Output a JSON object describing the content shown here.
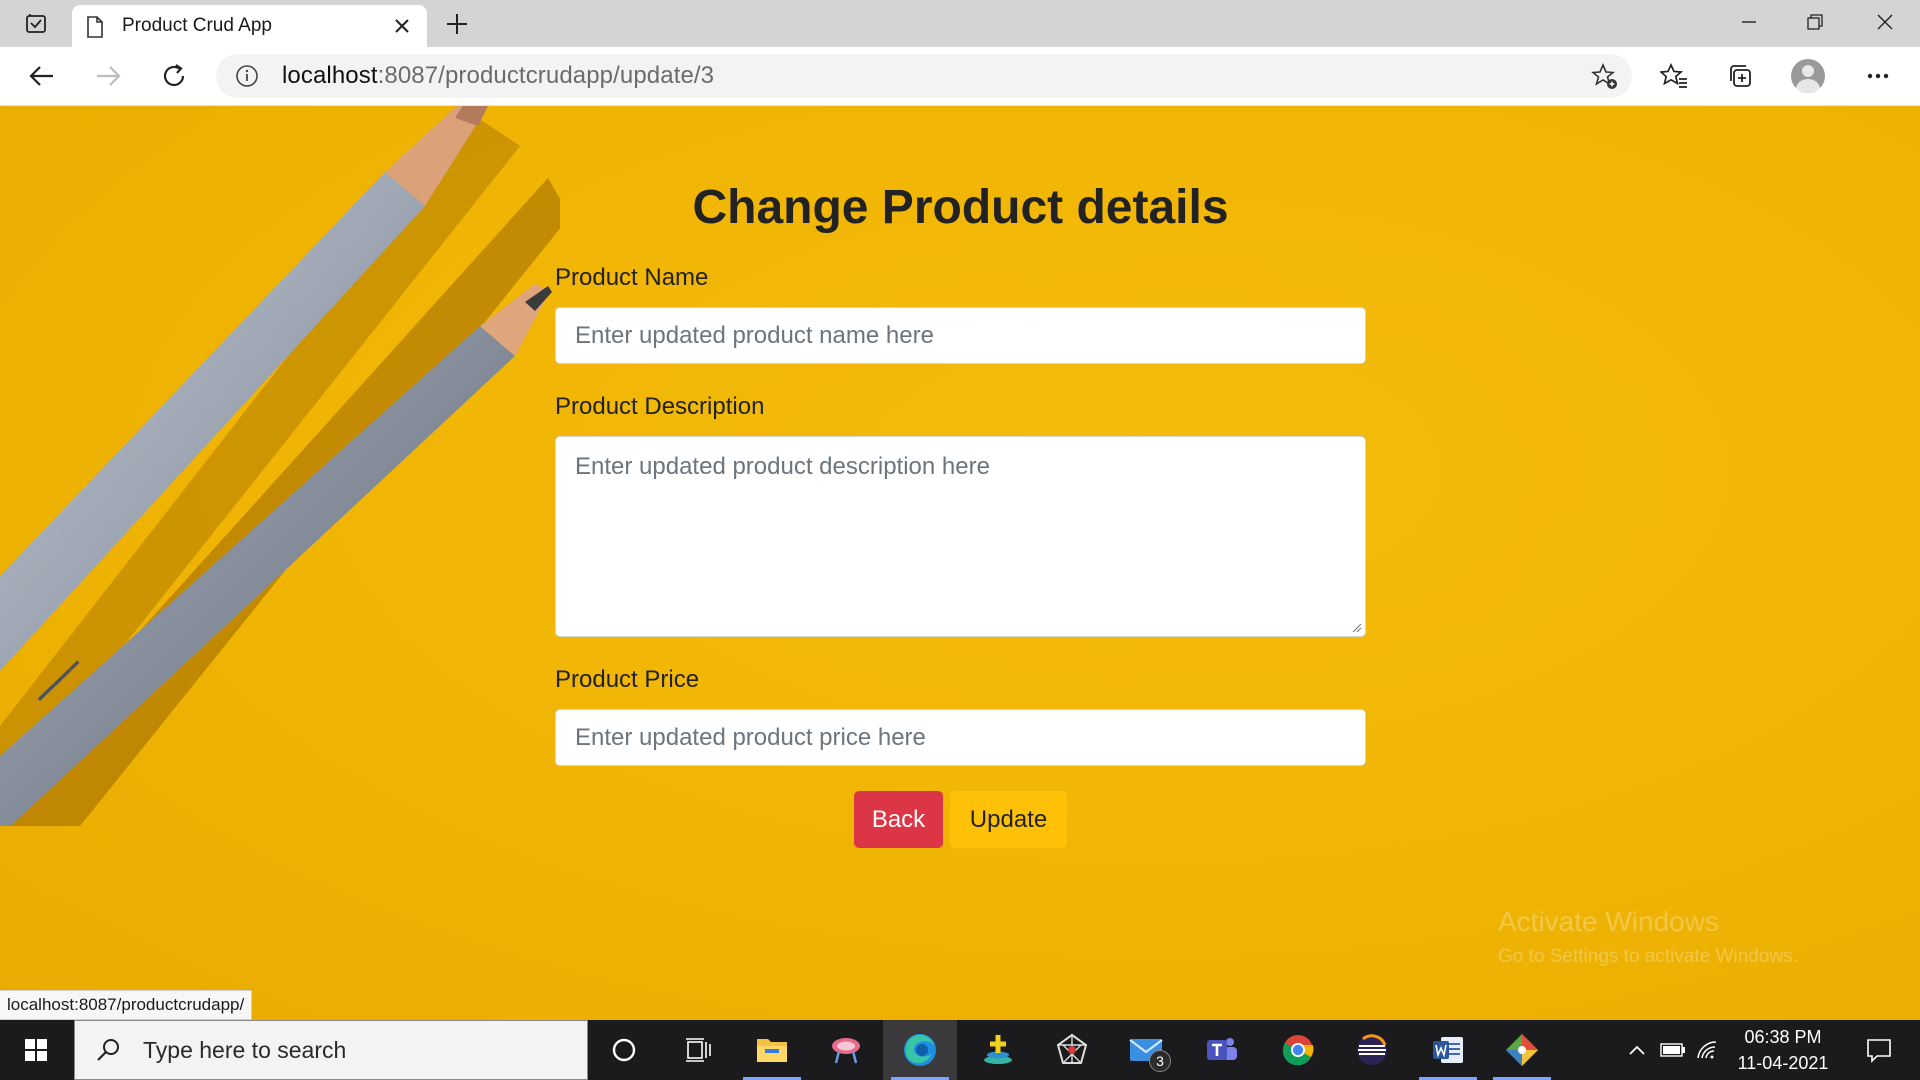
{
  "browser": {
    "tab_title": "Product Crud App",
    "url_host": "localhost",
    "url_path": ":8087/productcrudapp/update/3"
  },
  "form": {
    "heading": "Change Product details",
    "name_label": "Product Name",
    "name_placeholder": "Enter updated product name here",
    "description_label": "Product Description",
    "description_placeholder": "Enter updated product description here",
    "price_label": "Product Price",
    "price_placeholder": "Enter updated product price here",
    "back_label": "Back",
    "update_label": "Update"
  },
  "watermark": {
    "line1": "Activate Windows",
    "line2": "Go to Settings to activate Windows."
  },
  "status_url": "localhost:8087/productcrudapp/",
  "taskbar": {
    "search_placeholder": "Type here to search",
    "time": "06:38 PM",
    "date": "11-04-2021",
    "mail_badge": "3"
  },
  "colors": {
    "page_background": "#f2b705",
    "back_button": "#dc3545",
    "update_button": "#ffc107"
  }
}
